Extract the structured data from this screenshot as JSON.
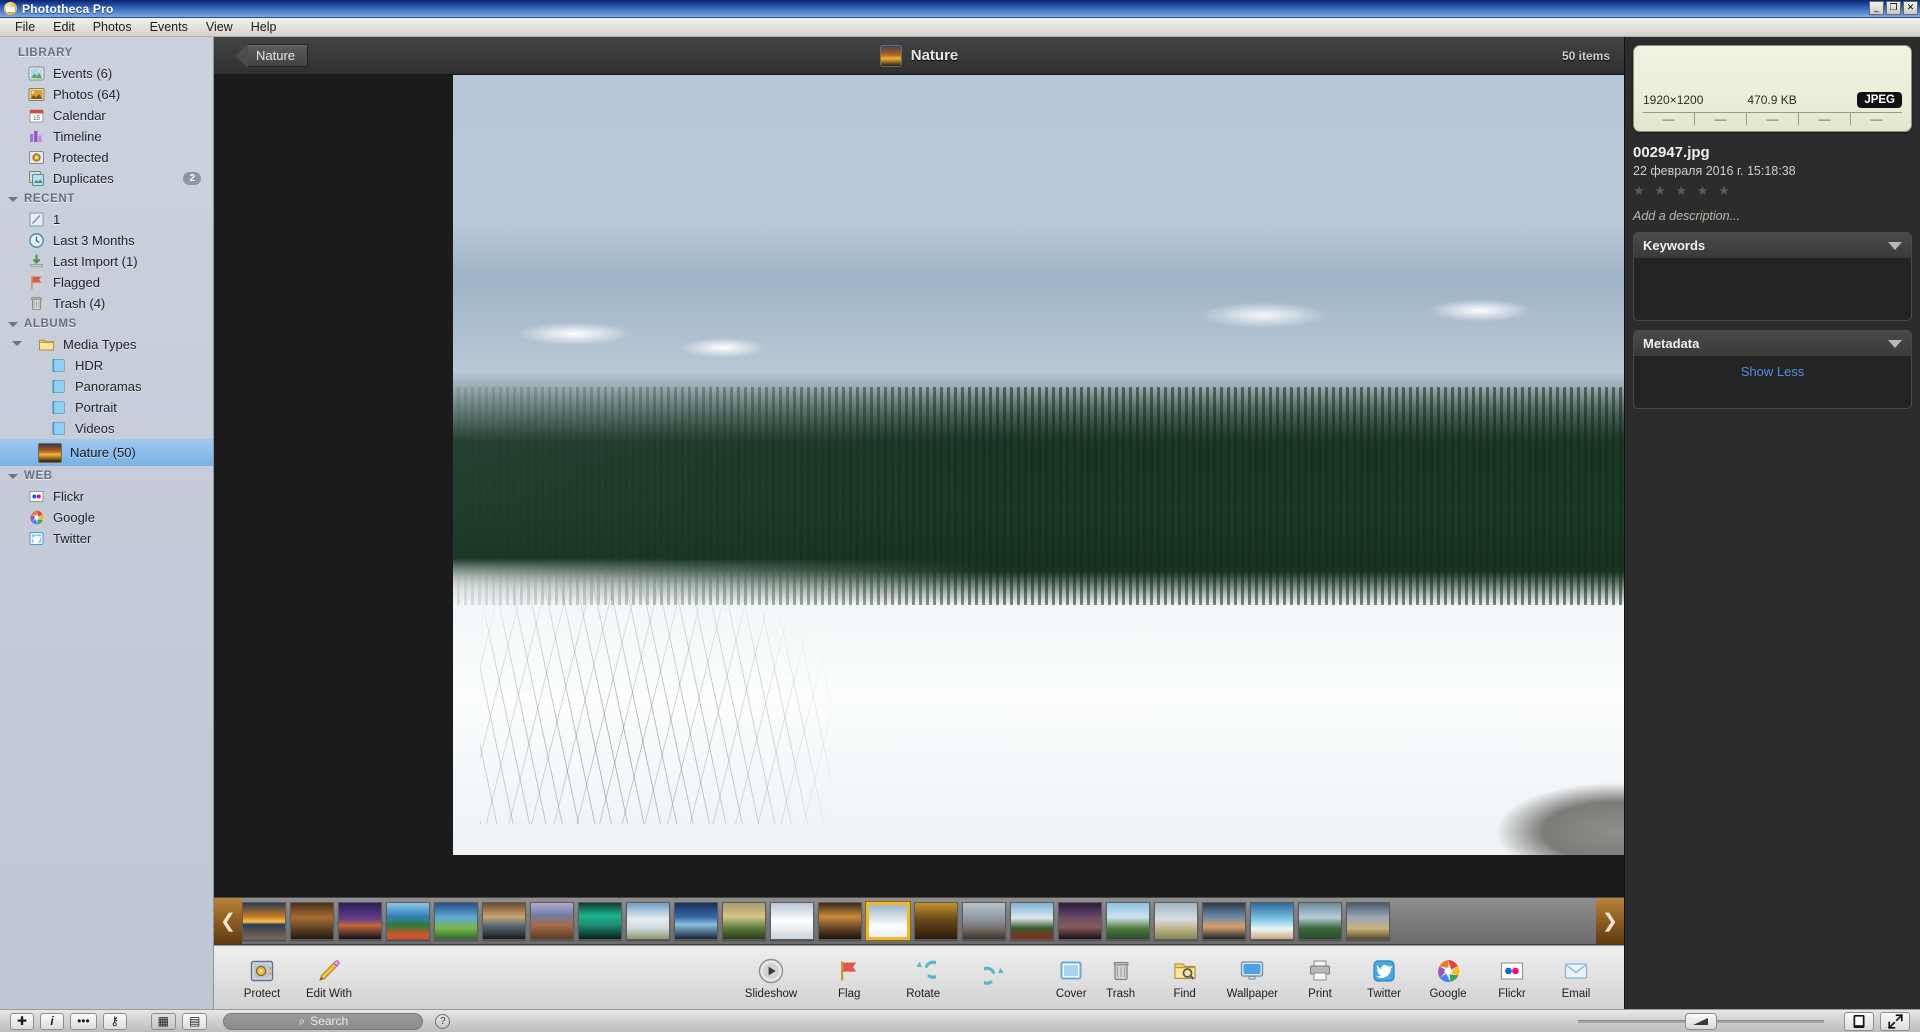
{
  "window": {
    "title": "Phototheca Pro",
    "icon": "app-icon",
    "buttons": [
      {
        "name": "minimize",
        "glyph": "_"
      },
      {
        "name": "maximize",
        "glyph": "❐"
      },
      {
        "name": "close",
        "glyph": "✕"
      }
    ]
  },
  "menubar": {
    "items": [
      "File",
      "Edit",
      "Photos",
      "Events",
      "View",
      "Help"
    ]
  },
  "sidebar": {
    "groups": [
      {
        "label": "LIBRARY",
        "collapsible": false,
        "items": [
          {
            "label": "Events (6)",
            "icon": "events-icon"
          },
          {
            "label": "Photos (64)",
            "icon": "photos-icon"
          },
          {
            "label": "Calendar",
            "icon": "calendar-icon"
          },
          {
            "label": "Timeline",
            "icon": "timeline-icon"
          },
          {
            "label": "Protected",
            "icon": "protected-icon"
          },
          {
            "label": "Duplicates",
            "icon": "duplicates-icon",
            "badge": "2"
          }
        ]
      },
      {
        "label": "RECENT",
        "collapsible": true,
        "items": [
          {
            "label": "1",
            "icon": "recent-search-icon"
          },
          {
            "label": "Last 3 Months",
            "icon": "clock-icon"
          },
          {
            "label": "Last Import (1)",
            "icon": "import-icon"
          },
          {
            "label": "Flagged",
            "icon": "flag-icon"
          },
          {
            "label": "Trash (4)",
            "icon": "trash-icon"
          }
        ]
      },
      {
        "label": "ALBUMS",
        "collapsible": true,
        "items": [
          {
            "label": "Media Types",
            "icon": "folder-icon",
            "expandable": true
          },
          {
            "label": "HDR",
            "icon": "album-icon",
            "indent": 2
          },
          {
            "label": "Panoramas",
            "icon": "album-icon",
            "indent": 2
          },
          {
            "label": "Portrait",
            "icon": "album-icon",
            "indent": 2
          },
          {
            "label": "Videos",
            "icon": "album-icon",
            "indent": 2
          },
          {
            "label": "Nature (50)",
            "icon": "nature-album-icon",
            "selected": true
          }
        ]
      },
      {
        "label": "WEB",
        "collapsible": true,
        "items": [
          {
            "label": "Flickr",
            "icon": "flickr-icon"
          },
          {
            "label": "Google",
            "icon": "google-icon"
          },
          {
            "label": "Twitter",
            "icon": "twitter-icon"
          }
        ]
      }
    ]
  },
  "topbar": {
    "back_label": "Nature",
    "title": "Nature",
    "item_count": "50 items"
  },
  "filmstrip": {
    "prev_glyph": "❮",
    "next_glyph": "❯",
    "selected_index": 13,
    "thumbs": [
      "linear-gradient(to bottom,#2b3b58 0%,#c87a22 38%,#f6c352 52%,#2e3c52 60%,#7a6a55 100%)",
      "linear-gradient(to bottom,#4a2f1b 0%,#a96d33 40%,#6b4a2c 65%,#23180f 100%)",
      "linear-gradient(to bottom,#2a1e55 0%,#6a3d8c 45%,#c46a3a 62%,#120c20 100%)",
      "linear-gradient(to bottom,#8cc8e6 0%,#2f7fb8 38%,#2f7a3a 62%,#d2532a 88%)",
      "linear-gradient(to bottom,#2a4e8c 0%,#5fa9d8 40%,#7ab648 70%,#2f6a2a 100%)",
      "linear-gradient(to bottom,#6f4a2c 0%,#caa571 38%,#5e6b78 62%,#1b1b1b 100%)",
      "linear-gradient(to bottom,#b8a9d6 0%,#6f7fa8 32%,#a86b4a 62%,#5a3b2a 100%)",
      "linear-gradient(to bottom,#0d3b34 0%,#19b58c 35%,#1e8f78 60%,#0a1f18 100%)",
      "linear-gradient(to bottom,#6f9fc8 0%,#e8eef4 45%,#cfd9df 70%,#8a9a6a 100%)",
      "linear-gradient(to bottom,#1b2f5a 0%,#3a6aa8 40%,#8fbede 60%,#16233a 100%)",
      "linear-gradient(to bottom,#a89a6a 0%,#d6c68a 38%,#5a7a3a 70%,#2a3a1a 100%)",
      "linear-gradient(to bottom,#b7c7d8 0%,#ffffff 50%,#e8eef2 72%,#c8d4dc 100%)",
      "linear-gradient(to bottom,#3a2a1a 0%,#c98b3a 38%,#6a4a2a 68%,#1a1208 100%)",
      "linear-gradient(to bottom,#9fb8cc 0%,#dfe8ee 46%,#ffffff 66%,#e6eef2 100%)",
      "linear-gradient(to bottom,#c8922a 0%,#6a4a1a 45%,#2a1a0a 100%)",
      "linear-gradient(to bottom,#b8c2cc 0%,#8a949e 48%,#6a6258 78%,#3a342c 100%)",
      "linear-gradient(to bottom,#7fb2d8 0%,#dce8ef 42%,#3a5a2a 70%,#8a2a1a 100%)",
      "linear-gradient(to bottom,#2a1a3a 0%,#6a4a6a 40%,#8a5a5a 66%,#1a0f1a 100%)",
      "linear-gradient(to bottom,#8fc2e0 0%,#cfe2ee 40%,#4a7a3a 72%,#2a4a2a 100%)",
      "linear-gradient(to bottom,#9fb4c4 0%,#d8dfe4 44%,#b8a87a 78%,#7a8a5a 100%)",
      "linear-gradient(to bottom,#2a3a4a 0%,#6a8aa8 38%,#d8a06a 66%,#1a2430 100%)",
      "linear-gradient(to bottom,#2a6a9a 0%,#7fc4e4 45%,#eef6fa 72%,#c8a87a 100%)",
      "linear-gradient(to bottom,#6a8a9a 0%,#b8cdd8 40%,#3a6a3a 70%,#2a4a2a 100%)",
      "linear-gradient(to bottom,#4a5a6a 0%,#9aa8b8 40%,#c8b07a 72%,#5a4a2a 100%)"
    ]
  },
  "actionbar": {
    "left": [
      {
        "label": "Protect",
        "icon": "safe-icon"
      },
      {
        "label": "Edit With",
        "icon": "pencil-icon"
      }
    ],
    "middle": [
      {
        "label": "Slideshow",
        "icon": "play-icon"
      },
      {
        "label": "Flag",
        "icon": "flag-icon"
      },
      {
        "label": "Rotate",
        "icon": "rotate-left-icon"
      },
      {
        "label": "",
        "icon": "rotate-right-icon"
      },
      {
        "label": "Cover",
        "icon": "cover-icon"
      }
    ],
    "right": [
      {
        "label": "Trash",
        "icon": "trash-icon"
      },
      {
        "label": "Find",
        "icon": "find-icon"
      },
      {
        "label": "Wallpaper",
        "icon": "wallpaper-icon"
      },
      {
        "label": "Print",
        "icon": "print-icon"
      },
      {
        "label": "Twitter",
        "icon": "twitter-icon"
      },
      {
        "label": "Google",
        "icon": "google-icon"
      },
      {
        "label": "Flickr",
        "icon": "flickr-icon"
      },
      {
        "label": "Email",
        "icon": "email-icon"
      }
    ]
  },
  "inspector": {
    "preview": {
      "dimensions": "1920×1200",
      "filesize": "470.9 KB",
      "filetype": "JPEG",
      "cells": [
        "—",
        "—",
        "—",
        "—",
        "—"
      ]
    },
    "filename": "002947.jpg",
    "date": "22 февраля 2016 г. 15:18:38",
    "rating": 0,
    "rating_max": 5,
    "description_placeholder": "Add a description...",
    "panels": [
      {
        "title": "Keywords",
        "body": ""
      },
      {
        "title": "Metadata",
        "body": "Show Less"
      }
    ]
  },
  "statusbar": {
    "buttons": [
      {
        "name": "add-button",
        "glyph": "✚"
      },
      {
        "name": "info-button",
        "glyph": "i"
      },
      {
        "name": "more-button",
        "glyph": "•••"
      },
      {
        "name": "key-button",
        "glyph": "⚷"
      }
    ],
    "view_toggles": [
      {
        "name": "grid-view-button",
        "glyph": "▦",
        "active": true
      },
      {
        "name": "list-view-button",
        "glyph": "▤",
        "active": false
      }
    ],
    "search_placeholder": "Search",
    "search_value": "",
    "help_glyph": "?",
    "right_buttons": [
      {
        "name": "single-view-button",
        "glyph": "▣"
      },
      {
        "name": "fullscreen-button",
        "glyph": "⤢"
      }
    ]
  },
  "colors": {
    "accent": "#4a90e2",
    "selection": "#79b2e6",
    "thumb_selected_border": "#f0b92b",
    "titlebar": "#2a5bb5"
  }
}
